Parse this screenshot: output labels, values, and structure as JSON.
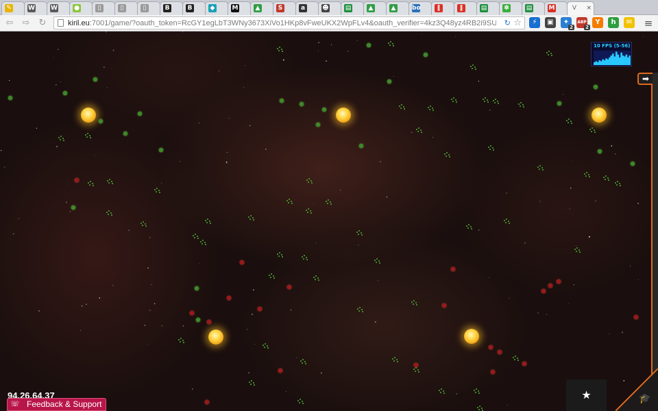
{
  "browser": {
    "tabs": [
      {
        "icon": "pen-icon",
        "glyph": "✎",
        "color": "#e8b400"
      },
      {
        "icon": "wordpress-icon",
        "glyph": "W",
        "color": "#5a5a5a"
      },
      {
        "icon": "wordpress-icon",
        "glyph": "W",
        "color": "#5a5a5a"
      },
      {
        "icon": "green-circle-icon",
        "glyph": "●",
        "color": "#8cc63f"
      },
      {
        "icon": "page-icon",
        "glyph": "▯",
        "color": "#9a9a9a"
      },
      {
        "icon": "page-icon",
        "glyph": "▯",
        "color": "#9a9a9a"
      },
      {
        "icon": "page-icon",
        "glyph": "▯",
        "color": "#9a9a9a"
      },
      {
        "icon": "b-icon",
        "glyph": "B",
        "color": "#222222"
      },
      {
        "icon": "b-icon",
        "glyph": "B",
        "color": "#222222"
      },
      {
        "icon": "location-pin-icon",
        "glyph": "◆",
        "color": "#1aa0b8"
      },
      {
        "icon": "m-icon",
        "glyph": "M",
        "color": "#111111"
      },
      {
        "icon": "drive-icon",
        "glyph": "▲",
        "color": "#2f9e44"
      },
      {
        "icon": "s-icon",
        "glyph": "S",
        "color": "#c0392b"
      },
      {
        "icon": "a-icon",
        "glyph": "a",
        "color": "#333333"
      },
      {
        "icon": "avatar-icon",
        "glyph": "☻",
        "color": "#444444"
      },
      {
        "icon": "sheets-icon",
        "glyph": "▤",
        "color": "#1e8e3e"
      },
      {
        "icon": "drive-icon",
        "glyph": "▲",
        "color": "#2f9e44"
      },
      {
        "icon": "drive-icon",
        "glyph": "▲",
        "color": "#2f9e44"
      },
      {
        "icon": "bo-icon",
        "glyph": "bo",
        "color": "#2b6fb8"
      },
      {
        "icon": "pause-icon",
        "glyph": "∥",
        "color": "#d93025"
      },
      {
        "icon": "pause-icon",
        "glyph": "∥",
        "color": "#d93025"
      },
      {
        "icon": "sheets-icon",
        "glyph": "▤",
        "color": "#1e8e3e"
      },
      {
        "icon": "leaf-icon",
        "glyph": "✽",
        "color": "#3cae3c"
      },
      {
        "icon": "sheets-icon",
        "glyph": "▤",
        "color": "#1e8e3e"
      },
      {
        "icon": "gmail-icon",
        "glyph": "M",
        "color": "#d93025"
      }
    ],
    "active_tab": {
      "icon": "v-icon",
      "title": "V",
      "close": "×"
    },
    "url_host": "kiril.eu",
    "url_path": ":7001/game/?oauth_token=RcGY1egLbT3WNy3673XiVo1HKp8vFweUKX2WpFLv4&oauth_verifier=4kz3Q48yz4RB2i9SUWdmqCNr4bI",
    "extensions": [
      {
        "icon": "feather-icon",
        "glyph": "⚡",
        "color": "#1a6fd0",
        "badge": ""
      },
      {
        "icon": "camera-icon",
        "glyph": "▣",
        "color": "#444444",
        "badge": ""
      },
      {
        "icon": "puzzle-icon",
        "glyph": "✦",
        "color": "#2a7fd4",
        "badge": "2"
      },
      {
        "icon": "adblock-icon",
        "glyph": "ABP",
        "color": "#c0392b",
        "badge": "2"
      },
      {
        "icon": "y-icon",
        "glyph": "Y",
        "color": "#f57c00",
        "badge": ""
      },
      {
        "icon": "h-icon",
        "glyph": "h",
        "color": "#2e9e3e",
        "badge": ""
      },
      {
        "icon": "note-icon",
        "glyph": "✉",
        "color": "#f2c200",
        "badge": ""
      }
    ],
    "menu_glyph": "≡"
  },
  "game": {
    "fps_label": "10 FPS (5-56)",
    "fps_samples": [
      3,
      4,
      3,
      5,
      4,
      6,
      5,
      7,
      6,
      8,
      10,
      12,
      9,
      14,
      11,
      8,
      13,
      10,
      9,
      11,
      8,
      10
    ],
    "ip": "94.26.64.37",
    "feedback_label": "Feedback & Support",
    "star_glyph": "★",
    "panel_toggle_glyph": "➡",
    "colors": {
      "accent": "#e06a1c",
      "feedback": "#b8154a",
      "friendly": "#3c8a2a",
      "enemy": "#9a1818",
      "sun": "#ffd84a"
    }
  }
}
